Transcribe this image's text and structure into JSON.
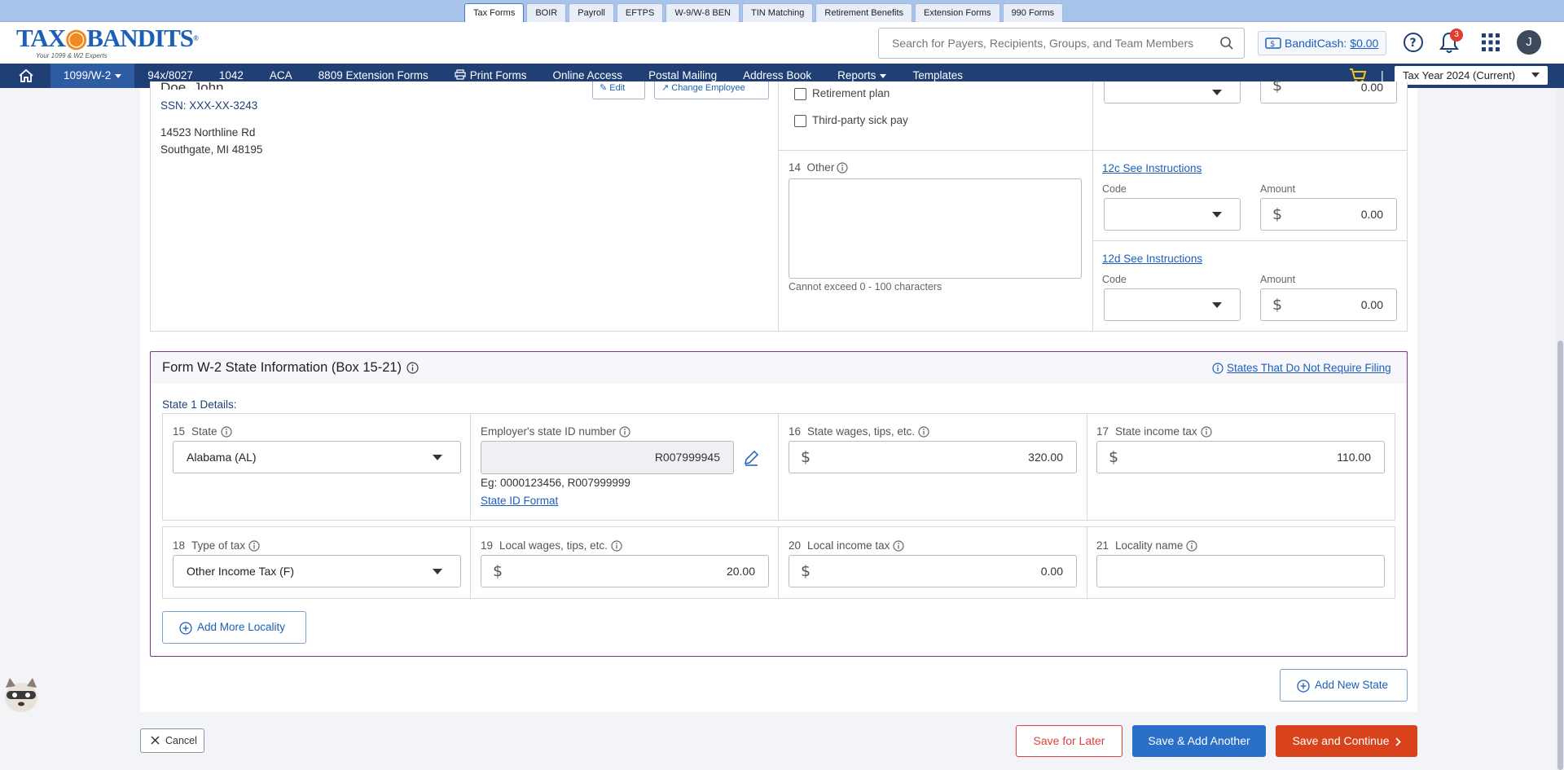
{
  "top_tabs": [
    "Tax Forms",
    "BOIR",
    "Payroll",
    "EFTPS",
    "W-9/W-8 BEN",
    "TIN Matching",
    "Retirement Benefits",
    "Extension Forms",
    "990 Forms"
  ],
  "logo": {
    "text_left": "TAX",
    "text_mid": "BANDITS",
    "tagline": "Your 1099 & W2 Experts",
    "reg": "®"
  },
  "search": {
    "placeholder": "Search for Payers, Recipients, Groups, and Team Members"
  },
  "bandit_cash": {
    "label": "BanditCash:",
    "amount": "$0.00"
  },
  "notifications": {
    "count": "3"
  },
  "user": {
    "initial": "J"
  },
  "nav": {
    "items": [
      {
        "label": "1099/W-2",
        "caret": true,
        "active": true
      },
      {
        "label": "94x/8027",
        "caret": false
      },
      {
        "label": "1042",
        "caret": false
      },
      {
        "label": "ACA",
        "caret": false
      },
      {
        "label": "8809 Extension Forms",
        "caret": false
      },
      {
        "label": "Print Forms",
        "caret": false,
        "icon": "printer-icon"
      },
      {
        "label": "Online Access",
        "caret": false
      },
      {
        "label": "Postal Mailing",
        "caret": false
      },
      {
        "label": "Address Book",
        "caret": false
      },
      {
        "label": "Reports",
        "caret": true
      },
      {
        "label": "Templates",
        "caret": false
      }
    ],
    "tax_year": "Tax Year 2024 (Current)",
    "separator": "|"
  },
  "employee": {
    "name": "Doe, John",
    "ssn": "SSN: XXX-XX-3243",
    "address1": "14523 Northline Rd",
    "address2": "Southgate, MI 48195",
    "edit_label": "Edit",
    "change_label": "Change Employee"
  },
  "box13": {
    "retirement_plan": "Retirement plan",
    "third_party_sick": "Third-party sick pay"
  },
  "box14": {
    "num": "14",
    "label": "Other",
    "hint": "Cannot exceed 0 - 100 characters"
  },
  "box12": {
    "top_amount": "0.00",
    "c": {
      "link": "12c See Instructions",
      "code_label": "Code",
      "amount_label": "Amount",
      "amount": "0.00"
    },
    "d": {
      "link": "12d See Instructions",
      "code_label": "Code",
      "amount_label": "Amount",
      "amount": "0.00"
    }
  },
  "state_section": {
    "title": "Form W-2 State Information (Box 15-21)",
    "states_link": "States That Do Not Require Filing",
    "state1_label": "State 1 Details:",
    "f15": {
      "num": "15",
      "label": "State",
      "value": "Alabama (AL)"
    },
    "fid": {
      "label": "Employer's state ID number",
      "value": "R007999945",
      "example": "Eg: 0000123456, R007999999",
      "format_link": "State ID Format"
    },
    "f16": {
      "num": "16",
      "label": "State wages, tips, etc.",
      "value": "320.00"
    },
    "f17": {
      "num": "17",
      "label": "State income tax",
      "value": "110.00"
    },
    "f18": {
      "num": "18",
      "label": "Type of tax",
      "value": "Other Income Tax (F)"
    },
    "f19": {
      "num": "19",
      "label": "Local wages, tips, etc.",
      "value": "20.00"
    },
    "f20": {
      "num": "20",
      "label": "Local income tax",
      "value": "0.00"
    },
    "f21": {
      "num": "21",
      "label": "Locality name",
      "value": ""
    },
    "add_locality": "Add More Locality"
  },
  "add_state": "Add New State",
  "actions": {
    "cancel": "Cancel",
    "save_later": "Save for Later",
    "save_add": "Save & Add Another",
    "save_continue": "Save and Continue"
  },
  "currency_symbol": "$",
  "colors": {
    "nav_bg": "#1f3f75",
    "brand_blue": "#1d5fb8",
    "state_border": "#7b3c86",
    "primary_btn": "#2a70c9",
    "continue_btn": "#d8431c",
    "save_later_text": "#d8453b"
  }
}
